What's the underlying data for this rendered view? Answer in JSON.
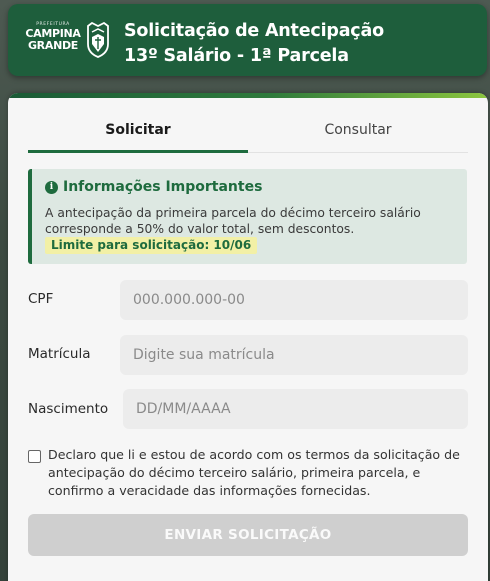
{
  "header": {
    "logo_small": "PREFEITURA",
    "logo_line1": "CAMPINA",
    "logo_line2": "GRANDE",
    "title_line1": "Solicitação de Antecipação",
    "title_line2": "13º Salário - 1ª Parcela"
  },
  "tabs": [
    {
      "label": "Solicitar",
      "active": true
    },
    {
      "label": "Consultar",
      "active": false
    }
  ],
  "info": {
    "icon": "info-circle-icon",
    "title": "Informações Importantes",
    "body": "A antecipação da primeira parcela do décimo terceiro salário corresponde a 50% do valor total, sem descontos.",
    "limit": "Limite para solicitação: 10/06"
  },
  "form": {
    "cpf": {
      "label": "CPF",
      "placeholder": "000.000.000-00",
      "value": ""
    },
    "matricula": {
      "label": "Matrícula",
      "placeholder": "Digite sua matrícula",
      "value": ""
    },
    "nascimento": {
      "label": "Nascimento",
      "placeholder": "DD/MM/AAAA",
      "value": ""
    },
    "declaration": "Declaro que li e estou de acordo com os termos da solicitação de antecipação do décimo terceiro salário, primeira parcela, e confirmo a veracidade das informações fornecidas.",
    "declaration_checked": false,
    "submit_label": "ENVIAR SOLICITAÇÃO"
  },
  "colors": {
    "brand_green": "#1e5e3c",
    "accent_green": "#1e6b3e",
    "highlight_yellow": "#f2f0a6",
    "disabled_button": "#cfcfcf"
  }
}
